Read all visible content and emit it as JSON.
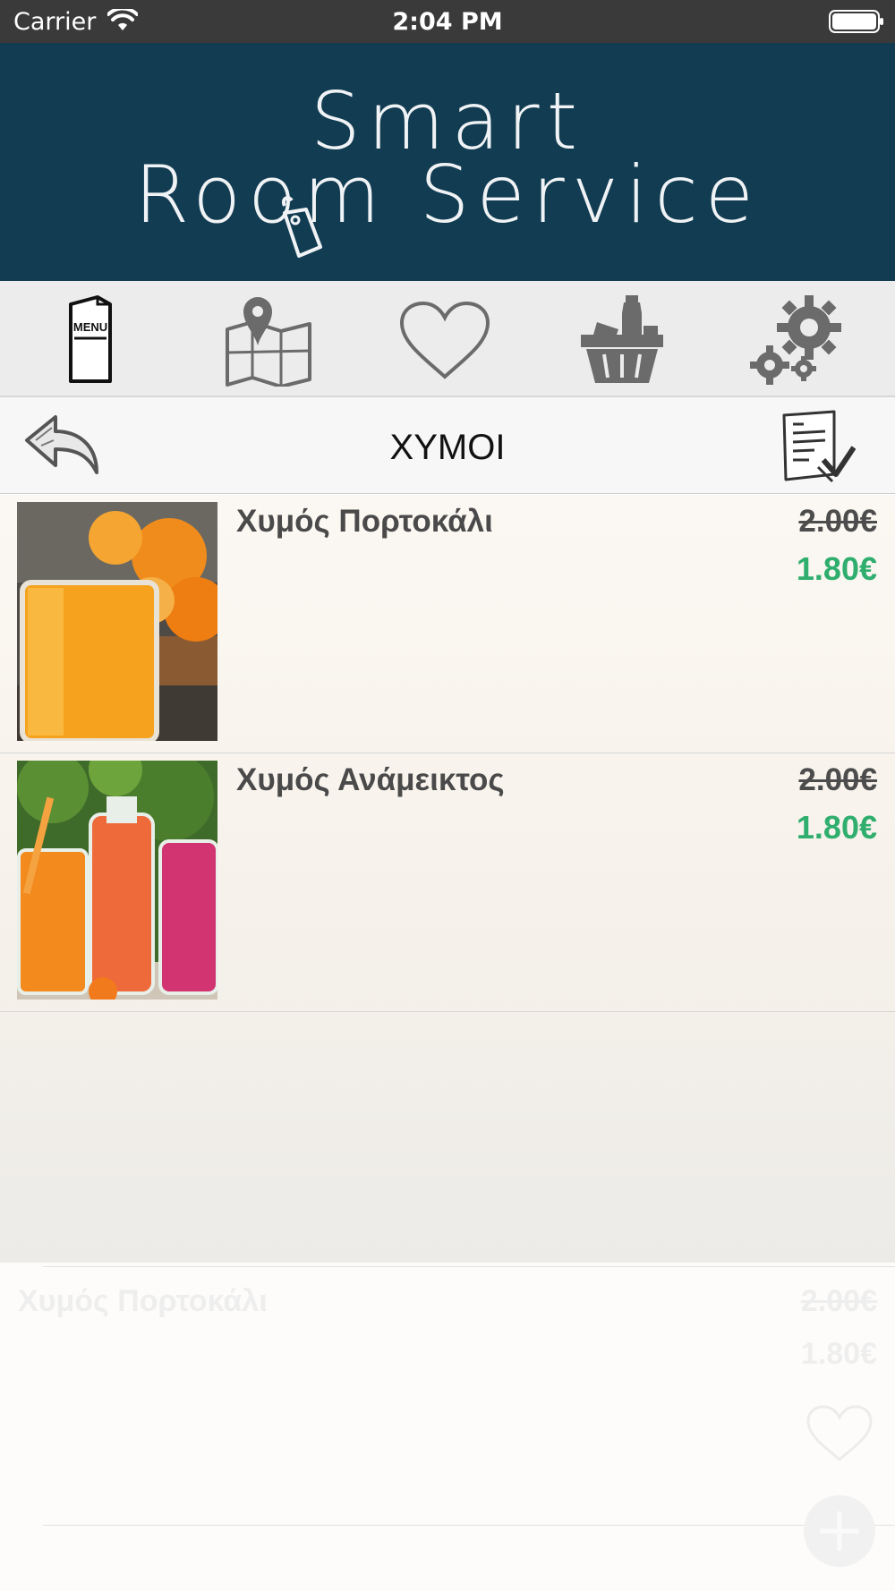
{
  "status_bar": {
    "carrier": "Carrier",
    "time": "2:04 PM"
  },
  "header": {
    "logo_line1": "Smart",
    "logo_line2": "Room Service"
  },
  "nav": {
    "items": [
      {
        "label": "MENU",
        "icon": "menu-card-icon"
      },
      {
        "icon": "map-icon"
      },
      {
        "icon": "heart-icon"
      },
      {
        "icon": "basket-icon"
      },
      {
        "icon": "settings-gears-icon"
      }
    ]
  },
  "subbar": {
    "title": "ΧΥΜΟΙ"
  },
  "products": [
    {
      "name": "Χυμός Πορτοκάλι",
      "old_price": "2.00€",
      "new_price": "1.80€"
    },
    {
      "name": "Χυμός Ανάμεικτος",
      "old_price": "2.00€",
      "new_price": "1.80€"
    }
  ],
  "ghost_item": {
    "name": "Χυμός Πορτοκάλι",
    "old_price": "2.00€",
    "new_price": "1.80€"
  },
  "colors": {
    "header_bg": "#123c52",
    "new_price": "#2fae6e",
    "old_price": "#4d4d4d",
    "icon_gray": "#6b6b6b"
  }
}
